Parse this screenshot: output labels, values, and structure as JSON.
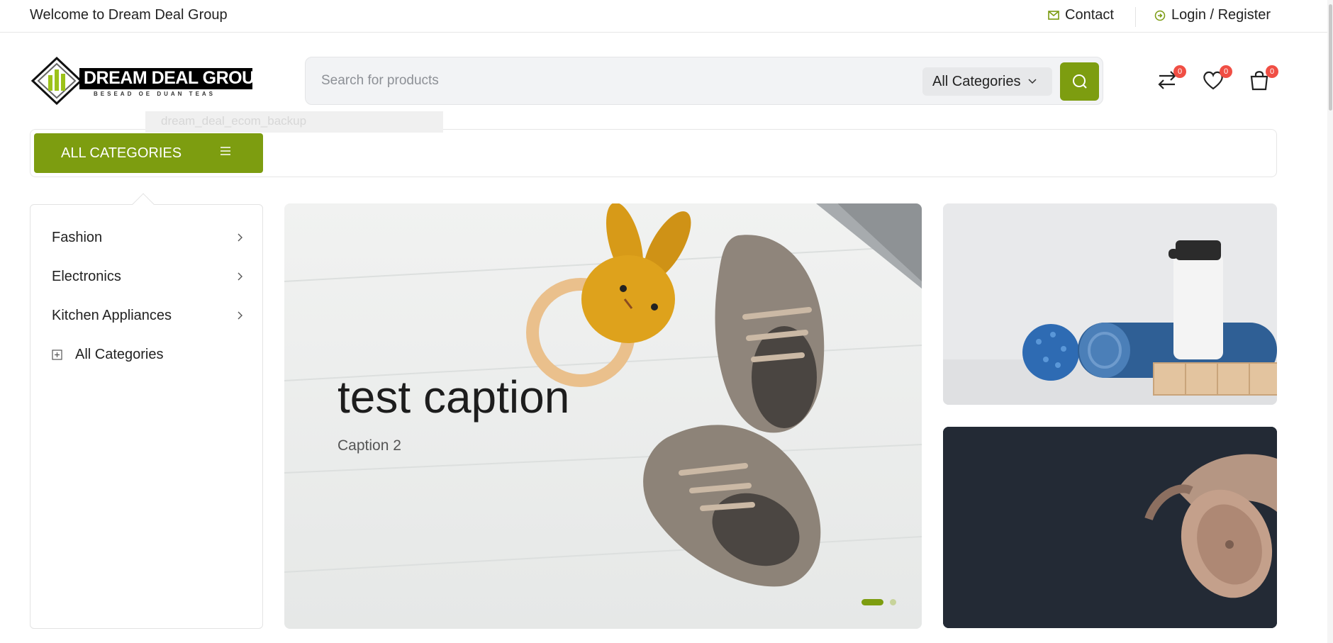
{
  "topbar": {
    "welcome": "Welcome to Dream Deal Group",
    "contact": "Contact",
    "login": "Login / Register"
  },
  "logo": {
    "name": "DREAM DEAL GROUP",
    "tagline": "BESEAD OE DUAN TEAS"
  },
  "search": {
    "placeholder": "Search for products",
    "value": "",
    "category": "All Categories"
  },
  "header_icons": {
    "compare_count": "0",
    "wishlist_count": "0",
    "cart_count": "0"
  },
  "tooltip": "dream_deal_ecom_backup",
  "all_categories_button": "ALL CATEGORIES",
  "sidebar": {
    "items": [
      {
        "label": "Fashion"
      },
      {
        "label": "Electronics"
      },
      {
        "label": "Kitchen Appliances"
      }
    ],
    "all_label": "All Categories"
  },
  "hero": {
    "caption": "test caption",
    "subcaption": "Caption 2",
    "slide_count": 2,
    "active_slide": 1
  },
  "promos": [
    {
      "image": "fitness-gear-photo"
    },
    {
      "image": "headphones-photo"
    }
  ],
  "colors": {
    "accent": "#7d9d10",
    "badge": "#f04e44",
    "promo_dark": "#232a35"
  }
}
